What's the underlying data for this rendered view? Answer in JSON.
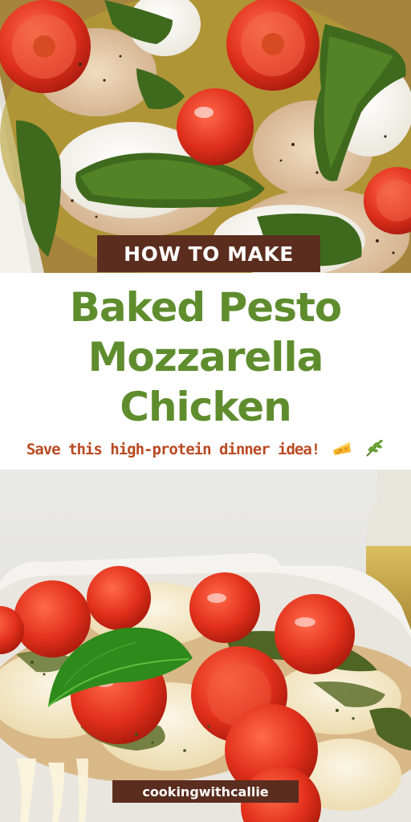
{
  "kicker": "HOW TO MAKE",
  "title_lines": [
    "Baked Pesto",
    "Mozzarella",
    "Chicken"
  ],
  "subtitle": "Save this high-protein dinner idea!",
  "brand": "cookingwithcallie",
  "colors": {
    "title_green": "#5f8d2e",
    "label_brown": "#5b2d1e",
    "subtitle_orange": "#b84a22"
  },
  "icons": [
    "cheese-icon",
    "herb-sprig-icon"
  ]
}
